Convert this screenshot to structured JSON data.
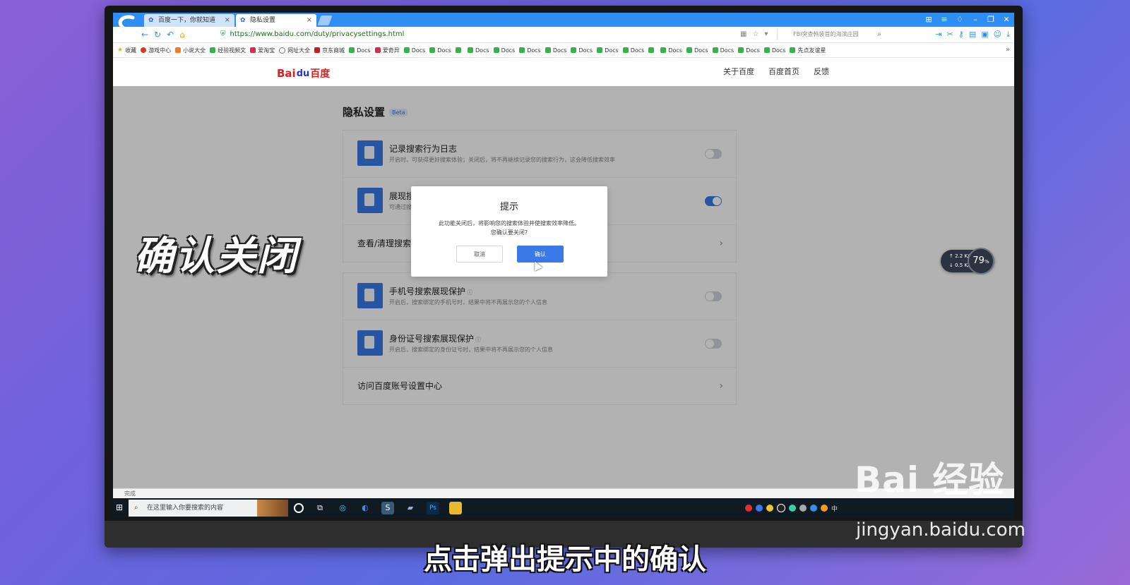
{
  "browser": {
    "tabs": [
      {
        "label": "百度一下，你就知道"
      },
      {
        "label": "隐私设置"
      }
    ],
    "url": "https://www.baidu.com/duty/privacysettings.html",
    "search_placeholder": "FBI突查韩装首的海滨庄园",
    "status": "完成"
  },
  "bookmarks": [
    {
      "label": "收藏",
      "icon": "star-icon"
    },
    {
      "label": "游戏中心",
      "icon": "game-icon"
    },
    {
      "label": "小说大全",
      "icon": "book-icon"
    },
    {
      "label": "经验视频文",
      "icon": "doc-icon"
    },
    {
      "label": "爱淘宝",
      "icon": "taobao-icon"
    },
    {
      "label": "网址大全",
      "icon": "globe-icon"
    },
    {
      "label": "京东商城",
      "icon": "jd-icon"
    },
    {
      "label": "Docs",
      "icon": "doc-icon"
    },
    {
      "label": "爱奇异",
      "icon": "iqiyi-icon"
    },
    {
      "label": "Docs",
      "icon": "doc-icon"
    },
    {
      "label": "Docs",
      "icon": "doc-icon"
    },
    {
      "label": "",
      "icon": "doc-icon"
    },
    {
      "label": "Docs",
      "icon": "doc-icon"
    },
    {
      "label": "Docs",
      "icon": "doc-icon"
    },
    {
      "label": "Docs",
      "icon": "doc-icon"
    },
    {
      "label": "Docs",
      "icon": "doc-icon"
    },
    {
      "label": "Docs",
      "icon": "doc-icon"
    },
    {
      "label": "Docs",
      "icon": "doc-icon"
    },
    {
      "label": "Docs",
      "icon": "doc-icon"
    },
    {
      "label": "",
      "icon": "doc-icon"
    },
    {
      "label": "Docs",
      "icon": "doc-icon"
    },
    {
      "label": "Docs",
      "icon": "doc-icon"
    },
    {
      "label": "Docs",
      "icon": "doc-icon"
    },
    {
      "label": "Docs",
      "icon": "doc-icon"
    },
    {
      "label": "Docs",
      "icon": "doc-icon"
    },
    {
      "label": "先点友谊星",
      "icon": "doc-icon"
    }
  ],
  "site": {
    "logo_text": {
      "bai": "Bai",
      "du": "du",
      "zh": "百度"
    },
    "header_links": [
      "关于百度",
      "百度首页",
      "反馈"
    ],
    "page_title": "隐私设置",
    "beta": "Beta"
  },
  "settings_group1": {
    "row1_title": "记录搜索行为日志",
    "row1_desc": "开启时，可获得更好搜索体验；关闭后，将不再继续记录您的搜索行为，这会降低搜索效率",
    "row1_on": false,
    "row2_title": "展现搜索历史",
    "row2_desc": "可通过搜索框查看历史记录",
    "row2_on": true,
    "link_label": "查看/清理搜索历史"
  },
  "settings_group2": {
    "row1_title": "手机号搜索展现保护",
    "row1_desc": "开启后，搜索绑定的手机号时，结果中将不再展示您的个人信息",
    "row1_on": false,
    "row2_title": "身份证号搜索展现保护",
    "row2_desc": "开启后，搜索绑定的身份证号时，结果中将不再展示您的个人信息",
    "row2_on": false,
    "link_label": "访问百度账号设置中心"
  },
  "dialog": {
    "title": "提示",
    "message_line1": "此功能关闭后，将影响您的搜索体验并使搜索效率降低。",
    "message_line2": "您确认要关闭?",
    "cancel": "取消",
    "confirm": "确认"
  },
  "taskbar": {
    "search_placeholder": "在这里输入你要搜索的内容",
    "ime": "中"
  },
  "speed_widget": {
    "up": "2.2",
    "down": "0.5",
    "unit": "K/s",
    "percent": "79",
    "percent_unit": "%"
  },
  "overlay_text": {
    "caption": "确认关闭",
    "subtitle": "点击弹出提示中的确认",
    "watermark": "Bai 经验",
    "watermark_url": "jingyan.baidu.com"
  },
  "colors": {
    "accent": "#3a7ae8",
    "tabbar": "#2f8ef4",
    "baidu_red": "#e21d1d"
  }
}
